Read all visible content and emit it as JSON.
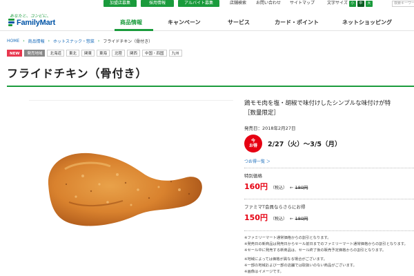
{
  "utility": {
    "buttons": [
      "加盟店募集",
      "採用情報",
      "アルバイト募集"
    ],
    "links": [
      "店舗検索",
      "お問い合わせ",
      "サイトマップ"
    ],
    "textsize_label": "文字サイズ",
    "textsize_options": [
      "小",
      "中",
      "大"
    ],
    "search_placeholder": "検索キーワード"
  },
  "logo": {
    "tagline": "あなたと、コンビに、",
    "name": "FamilyMart",
    "colors": {
      "green": "#1a9b3c",
      "blue": "#0054a6"
    }
  },
  "nav": {
    "items": [
      "商品情報",
      "キャンペーン",
      "サービス",
      "カード・ポイント",
      "ネットショッピング"
    ],
    "active_index": 0
  },
  "breadcrumb": [
    "HOME",
    "商品情報",
    "ホットスナック・惣菜",
    "フライドチキン（骨付き）"
  ],
  "regions": [
    "NEW",
    "発売地域",
    "北海道",
    "東北",
    "関東",
    "東海",
    "北陸",
    "関西",
    "中国・四国",
    "九州"
  ],
  "product": {
    "title": "フライドチキン（骨付き）",
    "description_line1": "鶏モモ肉を塩・胡椒で味付けしたシンプルな味付けが特",
    "description_line2": "［数量限定］",
    "release": "発売日：2018年2月27日",
    "sale_badge_line1": "今",
    "sale_badge_line2": "お得",
    "sale_period": "2/27（火）～3/5（月）",
    "stores_link": "つお得一覧 ＞"
  },
  "prices": [
    {
      "label": "特別価格",
      "price": "160円",
      "tax": "（税込）",
      "arrow": "←",
      "old": "180円"
    },
    {
      "label": "ファミマT会員ならさらにお得",
      "price": "150円",
      "tax": "（税込）",
      "arrow": "←",
      "old": "180円"
    }
  ],
  "notes": [
    "※ファミリーマート通常価格からの割引となります。",
    "※発売日の新商品は発売日からセール前日までのファミリーマート通常価格からの割引となります。",
    "※セール中に発売する新商品は、セール終了後の販売予定価格からの割引となります。",
    "",
    "※地域によっては価格が異なる場合がございます。",
    "※一部の地域および一部の店舗では取扱いのない商品がございます。",
    "※画像はイメージです。"
  ]
}
